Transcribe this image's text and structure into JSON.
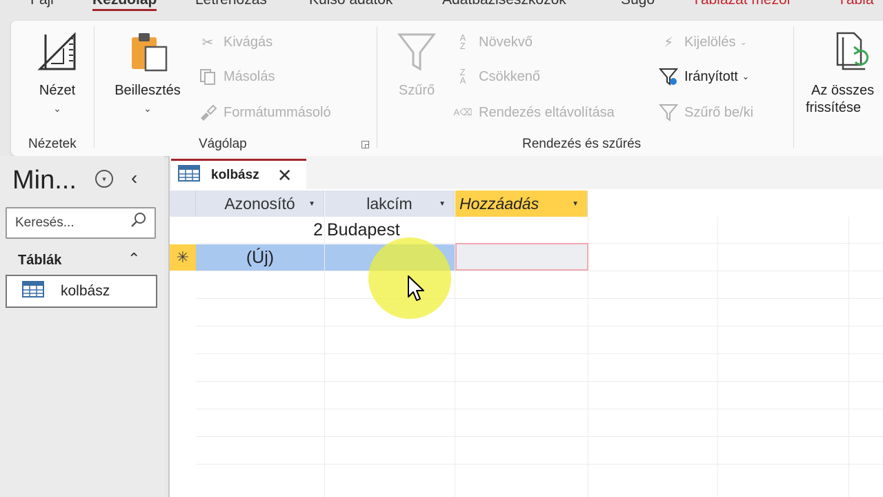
{
  "menu": {
    "tabs": [
      {
        "label": "Fájl"
      },
      {
        "label": "Kezdőlap"
      },
      {
        "label": "Létrehozás"
      },
      {
        "label": "Külső adatok"
      },
      {
        "label": "Adatbáziseszközök"
      },
      {
        "label": "Súgó"
      },
      {
        "label": "Táblázat mezői"
      },
      {
        "label": "Tábla"
      }
    ]
  },
  "ribbon": {
    "views": {
      "nezet": "Nézet",
      "group": "Nézetek"
    },
    "clipboard": {
      "paste": "Beillesztés",
      "cut": "Kivágás",
      "copy": "Másolás",
      "format_painter": "Formátummásoló",
      "group": "Vágólap"
    },
    "sortfilter": {
      "filter": "Szűrő",
      "ascending": "Növekvő",
      "descending": "Csökkenő",
      "remove_sort": "Rendezés eltávolítása",
      "selection": "Kijelölés",
      "advanced": "Irányított",
      "toggle_filter": "Szűrő be/ki",
      "group": "Rendezés és szűrés"
    },
    "records": {
      "refresh_line1": "Az összes",
      "refresh_line2": "frissítése"
    }
  },
  "nav": {
    "title": "Min...",
    "search_placeholder": "Keresés...",
    "section": "Táblák",
    "items": [
      {
        "label": "kolbász"
      }
    ]
  },
  "document": {
    "tab_title": "kolbász",
    "columns": [
      {
        "label": "Azonosító"
      },
      {
        "label": "lakcím"
      },
      {
        "label": "Hozzáadás"
      }
    ],
    "rows": [
      {
        "id": "2",
        "lakcim": "Budapest"
      }
    ],
    "new_row": {
      "marker": "✳",
      "id": "(Új)"
    }
  },
  "colors": {
    "accent": "#a4262c",
    "header_add": "#ffd04a",
    "selection": "#a9c8f0"
  }
}
